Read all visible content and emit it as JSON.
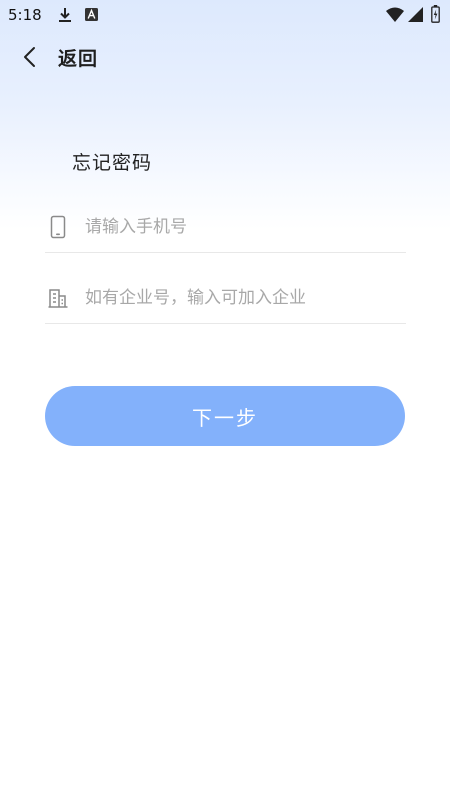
{
  "status_bar": {
    "time": "5:18",
    "icons": [
      "download-icon",
      "a-badge-icon",
      "wifi-icon",
      "signal-icon",
      "battery-icon"
    ]
  },
  "nav": {
    "back_label": "返回"
  },
  "title": "忘记密码",
  "form": {
    "phone": {
      "icon": "phone-icon",
      "placeholder": "请输入手机号",
      "value": ""
    },
    "company": {
      "icon": "building-icon",
      "placeholder": "如有企业号，输入可加入企业",
      "value": ""
    }
  },
  "next_button": {
    "label": "下一步",
    "color": "#83b1fb"
  },
  "colors": {
    "gradient_top": "#dde9fd",
    "background": "#ffffff",
    "divider": "#e8e8e8",
    "placeholder": "#a8a8a8"
  }
}
